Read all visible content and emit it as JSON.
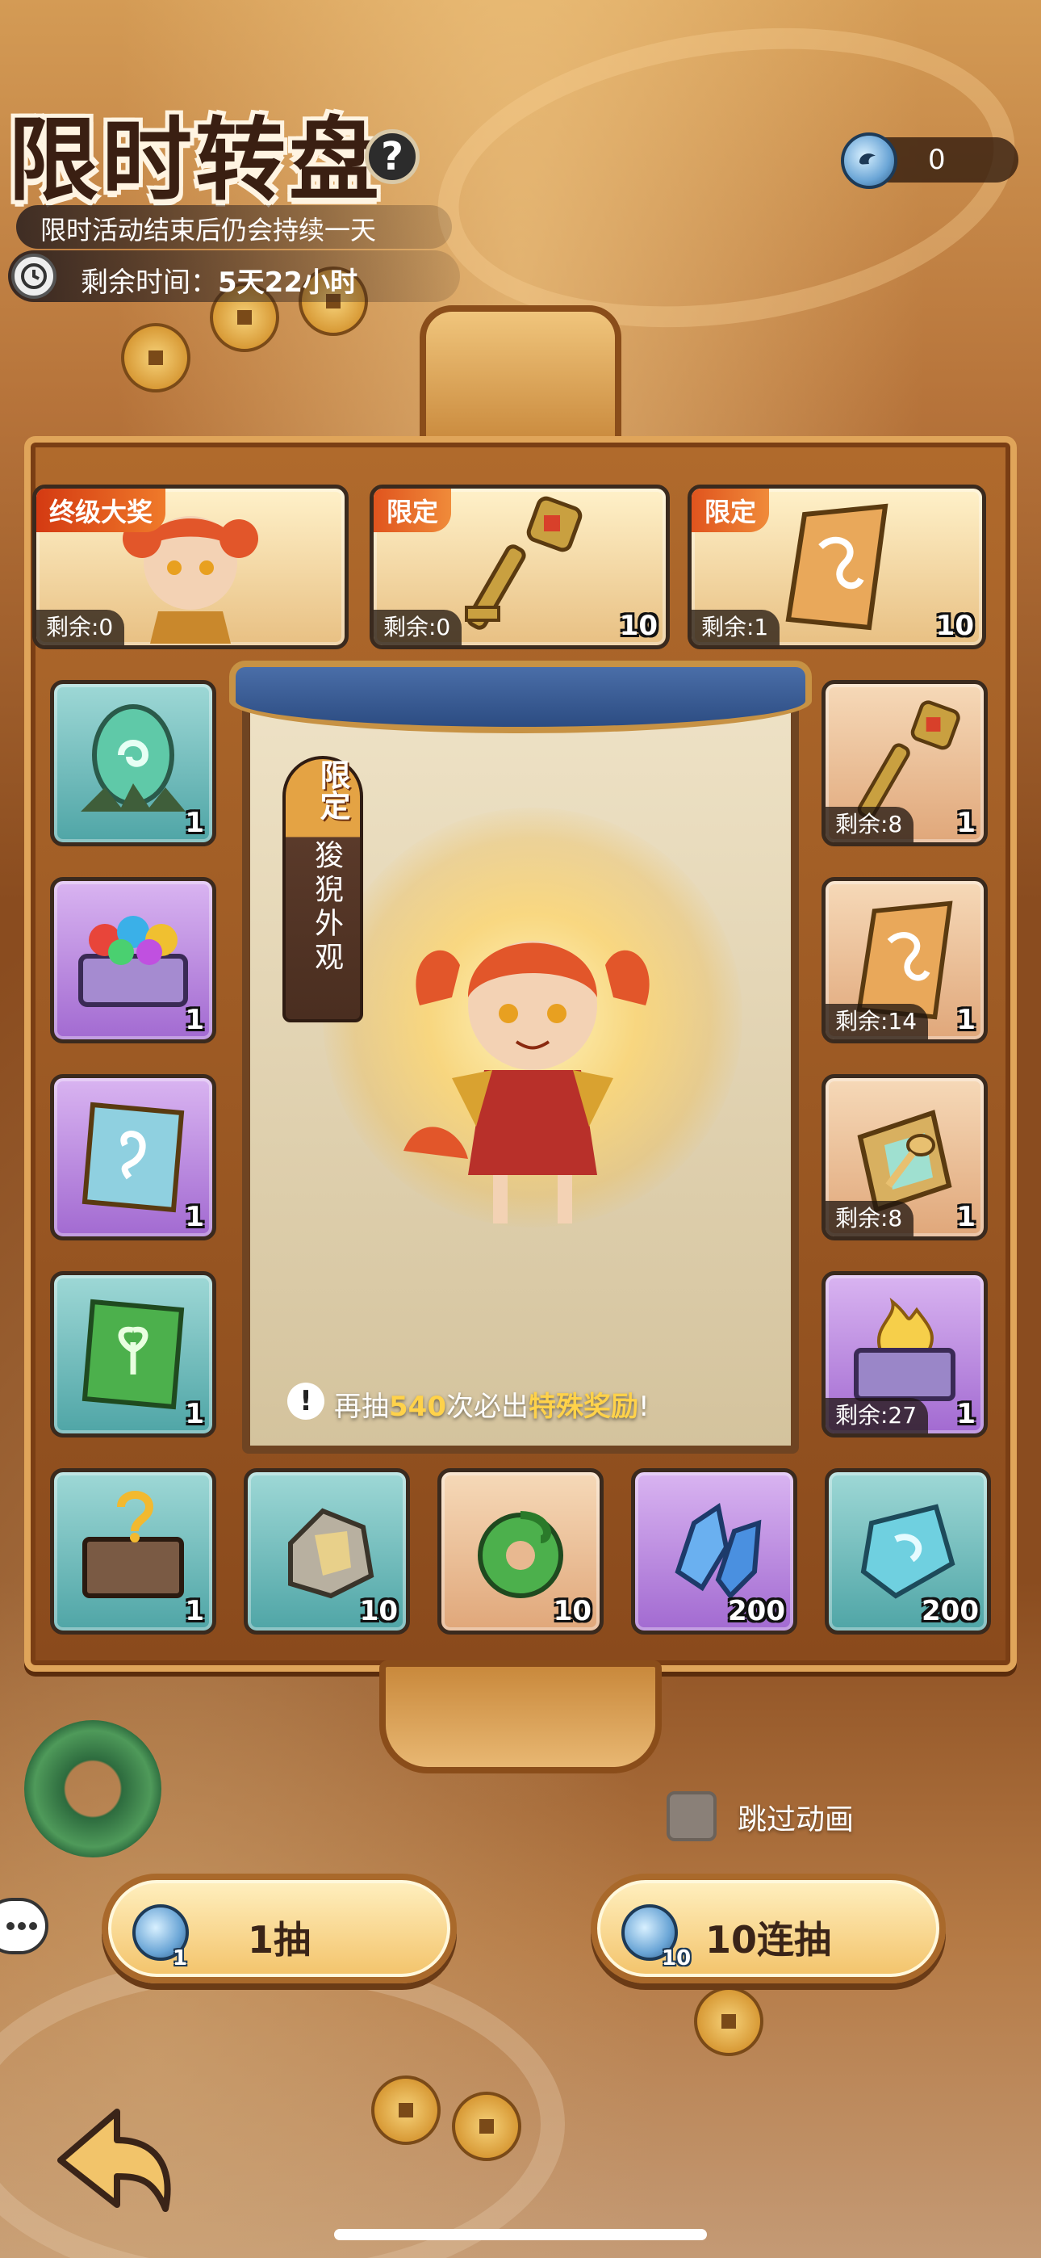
{
  "header": {
    "title": "限时转盘",
    "help_icon": "?",
    "subtitle": "限时活动结束后仍会持续一天",
    "time_label": "剩余时间：",
    "time_value": "5天22小时"
  },
  "currency": {
    "icon": "blue-coin-icon",
    "amount": "0"
  },
  "top_row": [
    {
      "tag": "终级大奖",
      "remain": "剩余:0",
      "qty": "",
      "icon": "character-portrait-icon"
    },
    {
      "tag": "限定",
      "remain": "剩余:0",
      "qty": "10",
      "icon": "golden-key-icon"
    },
    {
      "tag": "限定",
      "remain": "剩余:1",
      "qty": "10",
      "icon": "golden-ticket-icon"
    }
  ],
  "left_column": [
    {
      "qty": "1",
      "icon": "green-egg-icon",
      "color": "teal"
    },
    {
      "qty": "1",
      "icon": "gem-chest-icon",
      "color": "purple"
    },
    {
      "qty": "1",
      "icon": "purple-scroll-icon",
      "color": "purple"
    },
    {
      "qty": "1",
      "icon": "green-scroll-icon",
      "color": "teal"
    }
  ],
  "right_column": [
    {
      "remain": "剩余:8",
      "qty": "1",
      "icon": "golden-key-icon",
      "color": "orange"
    },
    {
      "remain": "剩余:14",
      "qty": "1",
      "icon": "golden-ticket-icon",
      "color": "orange"
    },
    {
      "remain": "剩余:8",
      "qty": "1",
      "icon": "spoon-plate-icon",
      "color": "orange"
    },
    {
      "remain": "剩余:27",
      "qty": "1",
      "icon": "fire-chest-icon",
      "color": "purple"
    }
  ],
  "bottom_row": [
    {
      "qty": "1",
      "icon": "mystery-chest-icon",
      "color": "teal"
    },
    {
      "qty": "10",
      "icon": "ore-stone-icon",
      "color": "teal"
    },
    {
      "qty": "10",
      "icon": "jade-coil-icon",
      "color": "orange"
    },
    {
      "qty": "200",
      "icon": "blue-crystal-icon",
      "color": "purple"
    },
    {
      "qty": "200",
      "icon": "cyan-gem-icon",
      "color": "teal"
    }
  ],
  "center": {
    "badge": "限定",
    "skin_label": "狻猊外观",
    "hint_prefix": "再抽",
    "hint_count": "540",
    "hint_middle": "次必出",
    "hint_highlight": "特殊奖励",
    "hint_suffix": "!"
  },
  "controls": {
    "skip_label": "跳过动画",
    "draw_one": {
      "label": "1抽",
      "cost": "1"
    },
    "draw_ten": {
      "label": "10连抽",
      "cost": "10"
    }
  },
  "colors": {
    "teal": "#4fa5a6",
    "purple": "#a26ad1",
    "orange": "#e0a77a",
    "tag": "#e0541e",
    "highlight": "#ffd24a"
  }
}
